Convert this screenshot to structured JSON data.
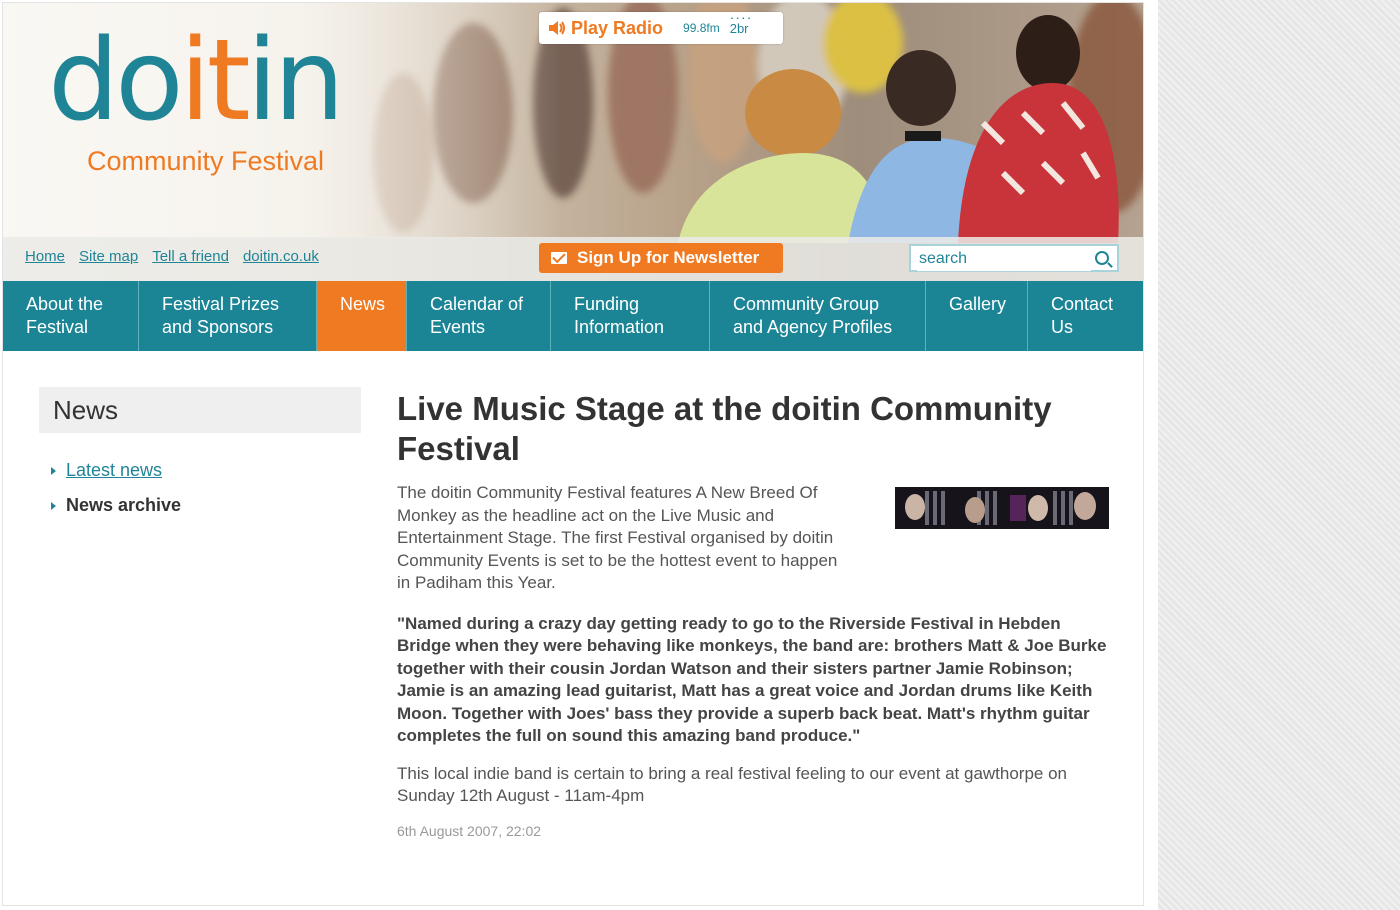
{
  "header": {
    "logo_part1": "do",
    "logo_part2": "it",
    "logo_part3": "in",
    "logo_subtitle": "Community Festival",
    "radio_label": "Play Radio",
    "radio_frequency": "99.8fm",
    "radio_station": "2br",
    "newsletter_label": "Sign Up for Newsletter",
    "search_placeholder": "search"
  },
  "util_links": [
    "Home",
    "Site map",
    "Tell a friend",
    "doitin.co.uk"
  ],
  "nav": [
    {
      "line1": "About the",
      "line2": "Festival",
      "active": false
    },
    {
      "line1": "Festival Prizes",
      "line2": "and Sponsors",
      "active": false
    },
    {
      "line1": "News",
      "line2": "",
      "active": true
    },
    {
      "line1": "Calendar of",
      "line2": "Events",
      "active": false
    },
    {
      "line1": "Funding",
      "line2": "Information",
      "active": false
    },
    {
      "line1": "Community Group",
      "line2": "and Agency Profiles",
      "active": false
    },
    {
      "line1": "Gallery",
      "line2": "",
      "active": false
    },
    {
      "line1": "Contact",
      "line2": "Us",
      "active": false
    }
  ],
  "sidebar": {
    "title": "News",
    "items": [
      {
        "label": "Latest news",
        "current": false
      },
      {
        "label": "News archive",
        "current": true
      }
    ]
  },
  "article": {
    "title": "Live Music Stage at the doitin Community Festival",
    "intro": "The doitin Community Festival features A New Breed Of Monkey as the headline act on the Live Music and Entertainment Stage. The first Festival organised by doitin Community Events is set to be the hottest event to happen in Padiham this Year.",
    "quote": "\"Named during a crazy day getting ready to go to the Riverside Festival in Hebden Bridge when they were behaving like monkeys, the band are: brothers Matt & Joe Burke together with their cousin Jordan Watson and their sisters partner Jamie Robinson; Jamie is an amazing lead guitarist, Matt has a great voice and Jordan drums like Keith Moon. Together with Joes' bass they provide a superb back beat. Matt's rhythm guitar completes the full on sound this amazing band produce.\"",
    "closing": "This local indie band is certain to bring a real festival feeling to our event at gawthorpe on Sunday 12th August - 11am-4pm",
    "date": "6th August 2007, 22:02"
  },
  "colors": {
    "teal": "#1b8596",
    "orange": "#ef7a22"
  }
}
